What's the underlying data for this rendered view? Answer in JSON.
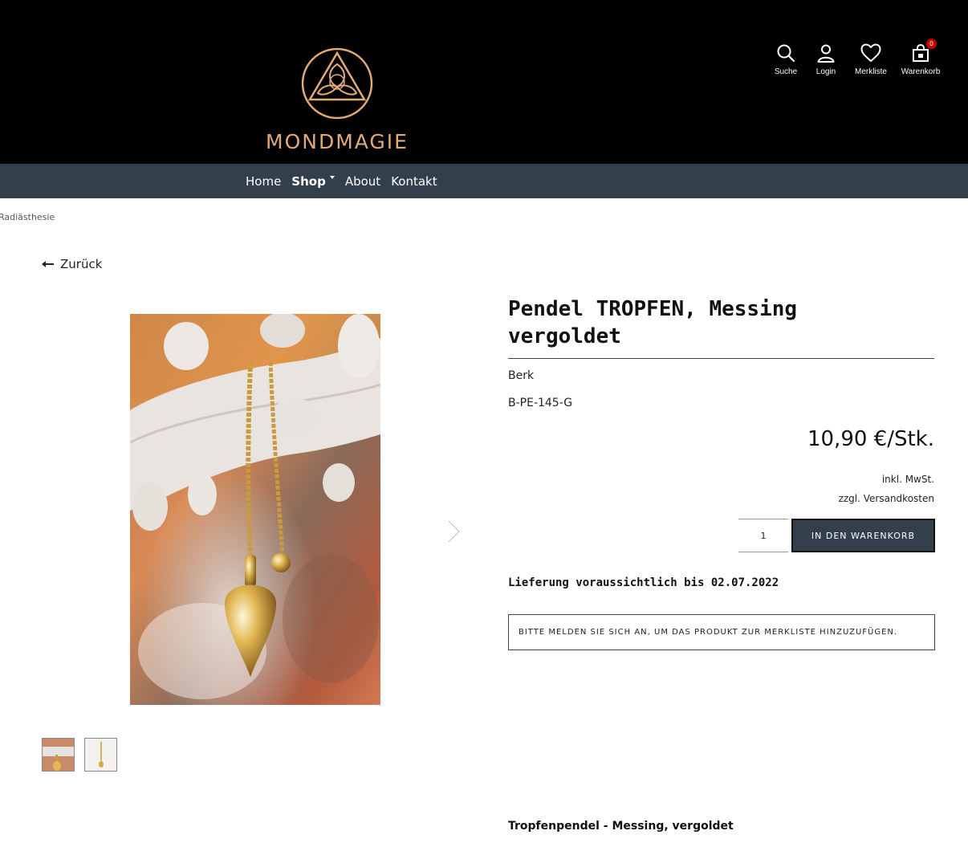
{
  "header": {
    "logo_text": "MONDMAGIE",
    "brand_color": "#e1aa76",
    "actions": [
      {
        "icon": "search-icon",
        "label": "Suche"
      },
      {
        "icon": "user-icon",
        "label": "Login"
      },
      {
        "icon": "heart-icon",
        "label": "Merkliste"
      },
      {
        "icon": "shopping-bag-icon",
        "label": "Warenkorb",
        "badge": "0"
      }
    ]
  },
  "nav": {
    "background": "#333f4b",
    "items": [
      {
        "label": "Home"
      },
      {
        "label": "Shop",
        "active": true,
        "dropdown": true
      },
      {
        "label": "About"
      },
      {
        "label": "Kontakt"
      }
    ]
  },
  "breadcrumb": "Radiästhesie",
  "back_label": "Zurück",
  "product": {
    "title": "Pendel TROPFEN, Messing vergoldet",
    "manufacturer": "Berk",
    "sku": "B-PE-145-G",
    "price": "10,90 €/Stk.",
    "tax_note": "inkl. MwSt.",
    "shipping_note": "zzgl. Versandkosten",
    "quantity": "1",
    "add_to_cart_label": "IN DEN WARENKORB",
    "delivery": "Lieferung voraussichtlich bis 02.07.2022",
    "wishlist_note": "BITTE MELDEN SIE SICH AN, UM DAS PRODUKT ZUR MERKLISTE HINZUZUFÜGEN.",
    "description_heading": "Tropfenpendel - Messing, vergoldet"
  }
}
